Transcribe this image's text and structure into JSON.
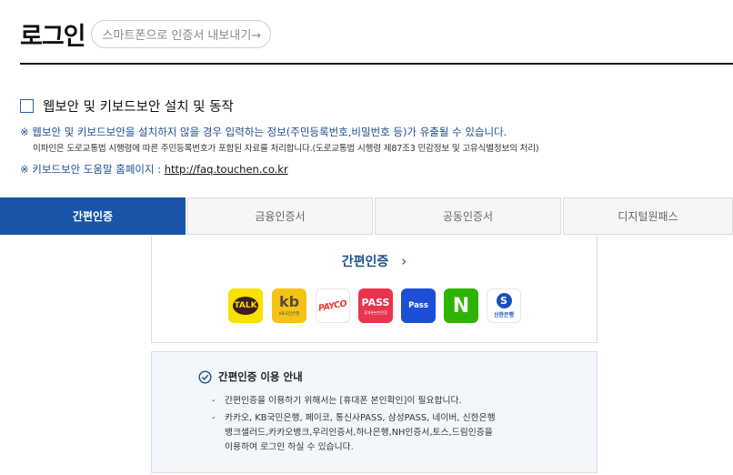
{
  "header": {
    "title": "로그인",
    "export_button": "스마트폰으로 인증서 내보내기→"
  },
  "install": {
    "label": "웹보안 및 키보드보안 설치 및 동작",
    "checked": false
  },
  "notices": {
    "warning": "※ 웹보안 및 키보드보안을 설치하지 않을 경우 입력하는 정보(주민등록번호,비밀번호 등)가 유출될 수 있습니다.",
    "privacy": "이파인은 도로교통법 시행령에 따른 주민등록번호가 포함된 자료를 처리합니다.(도로교통법 시행령 제87조3 민감정보 및 고유식별정보의 처리)",
    "help_prefix": "※ 키보드보안 도움말 홈페이지 : ",
    "help_link": "http://faq.touchen.co.kr"
  },
  "tabs": [
    {
      "label": "간편인증",
      "active": true
    },
    {
      "label": "금융인증서",
      "active": false
    },
    {
      "label": "공동인증서",
      "active": false
    },
    {
      "label": "디지털원패스",
      "active": false
    }
  ],
  "simple_auth": {
    "heading": "간편인증",
    "providers": [
      {
        "name": "kakao-icon",
        "text": "TALK",
        "color": "#fae100"
      },
      {
        "name": "kb-icon",
        "text": "kb",
        "sub": "KB국민은행",
        "color": "#f5c316"
      },
      {
        "name": "payco-icon",
        "text": "PAYCO",
        "color": "#e53935"
      },
      {
        "name": "pass-icon",
        "text": "PASS",
        "sub": "휴대폰본인인증",
        "color": "#e8344e"
      },
      {
        "name": "samsung-pass-icon",
        "text": "Pass",
        "color": "#1c4fd6"
      },
      {
        "name": "naver-icon",
        "text": "N",
        "color": "#2db400"
      },
      {
        "name": "shinhan-icon",
        "text": "S",
        "sub": "신한은행",
        "color": "#1a4fba"
      }
    ]
  },
  "guide": {
    "title": "간편인증 이용 안내",
    "items": [
      "간편인증을 이용하기 위해서는 [휴대폰 본인확인]이 필요합니다.",
      "카카오, KB국민은행, 페이코, 통신사PASS, 삼성PASS, 네이버, 신한은행",
      "뱅크샐러드,카카오뱅크,우리인증서,하나은행,NH인증서,토스,드림인증을",
      "이용하여 로그인 하실 수 있습니다."
    ]
  },
  "colors": {
    "accent": "#1855a8",
    "notice_text": "#1d4f8c"
  }
}
